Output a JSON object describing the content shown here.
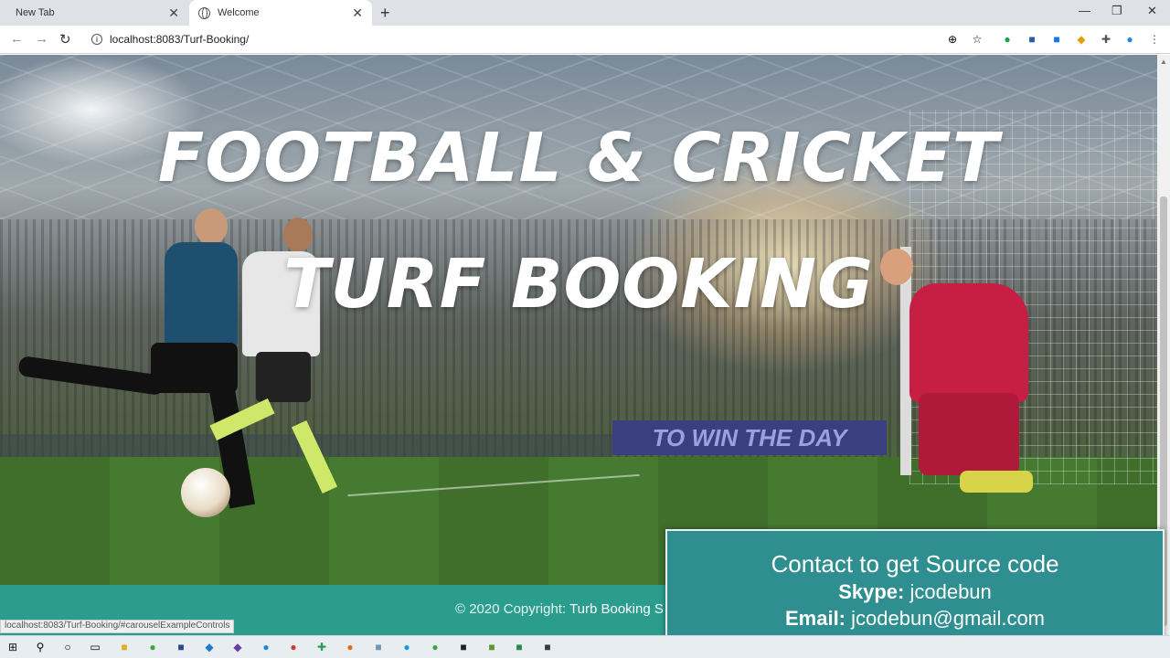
{
  "browser": {
    "tabs": [
      {
        "label": "New Tab",
        "active": false
      },
      {
        "label": "Welcome",
        "active": true
      }
    ],
    "close_glyph": "✕",
    "new_tab_glyph": "+",
    "url": "localhost:8083/Turf-Booking/",
    "window_controls": {
      "minimize": "—",
      "maximize": "❐",
      "close": "✕"
    },
    "nav": {
      "back": "←",
      "forward": "→",
      "reload": "↻"
    }
  },
  "hero": {
    "title_line1": "FOOTBALL & CRICKET",
    "title_line2": "TURF BOOKING",
    "banner_text": "TO WIN THE DAY"
  },
  "footer": {
    "copyright_prefix": "© 2020 Copyright: ",
    "copyright_brand": "Turb Booking S",
    "status_url": "localhost:8083/Turf-Booking/#carouselExampleControls"
  },
  "contact": {
    "heading": "Contact to get Source code",
    "skype_label": "Skype:",
    "skype_value": " jcodebun",
    "email_label": "Email:",
    "email_value": " jcodebun@gmail.com"
  },
  "colors": {
    "footer_bg": "#2a9d8f",
    "contact_bg": "#2f8e8f"
  }
}
